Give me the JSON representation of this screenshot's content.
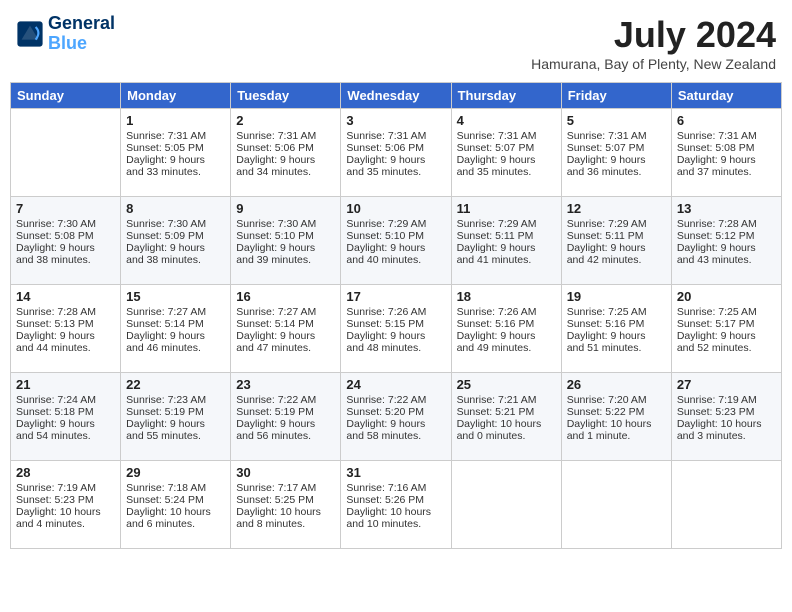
{
  "header": {
    "logo_line1": "General",
    "logo_line2": "Blue",
    "month_year": "July 2024",
    "location": "Hamurana, Bay of Plenty, New Zealand"
  },
  "days_of_week": [
    "Sunday",
    "Monday",
    "Tuesday",
    "Wednesday",
    "Thursday",
    "Friday",
    "Saturday"
  ],
  "weeks": [
    [
      {
        "day": "",
        "sunrise": "",
        "sunset": "",
        "daylight": ""
      },
      {
        "day": "1",
        "sunrise": "Sunrise: 7:31 AM",
        "sunset": "Sunset: 5:05 PM",
        "daylight": "Daylight: 9 hours and 33 minutes."
      },
      {
        "day": "2",
        "sunrise": "Sunrise: 7:31 AM",
        "sunset": "Sunset: 5:06 PM",
        "daylight": "Daylight: 9 hours and 34 minutes."
      },
      {
        "day": "3",
        "sunrise": "Sunrise: 7:31 AM",
        "sunset": "Sunset: 5:06 PM",
        "daylight": "Daylight: 9 hours and 35 minutes."
      },
      {
        "day": "4",
        "sunrise": "Sunrise: 7:31 AM",
        "sunset": "Sunset: 5:07 PM",
        "daylight": "Daylight: 9 hours and 35 minutes."
      },
      {
        "day": "5",
        "sunrise": "Sunrise: 7:31 AM",
        "sunset": "Sunset: 5:07 PM",
        "daylight": "Daylight: 9 hours and 36 minutes."
      },
      {
        "day": "6",
        "sunrise": "Sunrise: 7:31 AM",
        "sunset": "Sunset: 5:08 PM",
        "daylight": "Daylight: 9 hours and 37 minutes."
      }
    ],
    [
      {
        "day": "7",
        "sunrise": "Sunrise: 7:30 AM",
        "sunset": "Sunset: 5:08 PM",
        "daylight": "Daylight: 9 hours and 38 minutes."
      },
      {
        "day": "8",
        "sunrise": "Sunrise: 7:30 AM",
        "sunset": "Sunset: 5:09 PM",
        "daylight": "Daylight: 9 hours and 38 minutes."
      },
      {
        "day": "9",
        "sunrise": "Sunrise: 7:30 AM",
        "sunset": "Sunset: 5:10 PM",
        "daylight": "Daylight: 9 hours and 39 minutes."
      },
      {
        "day": "10",
        "sunrise": "Sunrise: 7:29 AM",
        "sunset": "Sunset: 5:10 PM",
        "daylight": "Daylight: 9 hours and 40 minutes."
      },
      {
        "day": "11",
        "sunrise": "Sunrise: 7:29 AM",
        "sunset": "Sunset: 5:11 PM",
        "daylight": "Daylight: 9 hours and 41 minutes."
      },
      {
        "day": "12",
        "sunrise": "Sunrise: 7:29 AM",
        "sunset": "Sunset: 5:11 PM",
        "daylight": "Daylight: 9 hours and 42 minutes."
      },
      {
        "day": "13",
        "sunrise": "Sunrise: 7:28 AM",
        "sunset": "Sunset: 5:12 PM",
        "daylight": "Daylight: 9 hours and 43 minutes."
      }
    ],
    [
      {
        "day": "14",
        "sunrise": "Sunrise: 7:28 AM",
        "sunset": "Sunset: 5:13 PM",
        "daylight": "Daylight: 9 hours and 44 minutes."
      },
      {
        "day": "15",
        "sunrise": "Sunrise: 7:27 AM",
        "sunset": "Sunset: 5:14 PM",
        "daylight": "Daylight: 9 hours and 46 minutes."
      },
      {
        "day": "16",
        "sunrise": "Sunrise: 7:27 AM",
        "sunset": "Sunset: 5:14 PM",
        "daylight": "Daylight: 9 hours and 47 minutes."
      },
      {
        "day": "17",
        "sunrise": "Sunrise: 7:26 AM",
        "sunset": "Sunset: 5:15 PM",
        "daylight": "Daylight: 9 hours and 48 minutes."
      },
      {
        "day": "18",
        "sunrise": "Sunrise: 7:26 AM",
        "sunset": "Sunset: 5:16 PM",
        "daylight": "Daylight: 9 hours and 49 minutes."
      },
      {
        "day": "19",
        "sunrise": "Sunrise: 7:25 AM",
        "sunset": "Sunset: 5:16 PM",
        "daylight": "Daylight: 9 hours and 51 minutes."
      },
      {
        "day": "20",
        "sunrise": "Sunrise: 7:25 AM",
        "sunset": "Sunset: 5:17 PM",
        "daylight": "Daylight: 9 hours and 52 minutes."
      }
    ],
    [
      {
        "day": "21",
        "sunrise": "Sunrise: 7:24 AM",
        "sunset": "Sunset: 5:18 PM",
        "daylight": "Daylight: 9 hours and 54 minutes."
      },
      {
        "day": "22",
        "sunrise": "Sunrise: 7:23 AM",
        "sunset": "Sunset: 5:19 PM",
        "daylight": "Daylight: 9 hours and 55 minutes."
      },
      {
        "day": "23",
        "sunrise": "Sunrise: 7:22 AM",
        "sunset": "Sunset: 5:19 PM",
        "daylight": "Daylight: 9 hours and 56 minutes."
      },
      {
        "day": "24",
        "sunrise": "Sunrise: 7:22 AM",
        "sunset": "Sunset: 5:20 PM",
        "daylight": "Daylight: 9 hours and 58 minutes."
      },
      {
        "day": "25",
        "sunrise": "Sunrise: 7:21 AM",
        "sunset": "Sunset: 5:21 PM",
        "daylight": "Daylight: 10 hours and 0 minutes."
      },
      {
        "day": "26",
        "sunrise": "Sunrise: 7:20 AM",
        "sunset": "Sunset: 5:22 PM",
        "daylight": "Daylight: 10 hours and 1 minute."
      },
      {
        "day": "27",
        "sunrise": "Sunrise: 7:19 AM",
        "sunset": "Sunset: 5:23 PM",
        "daylight": "Daylight: 10 hours and 3 minutes."
      }
    ],
    [
      {
        "day": "28",
        "sunrise": "Sunrise: 7:19 AM",
        "sunset": "Sunset: 5:23 PM",
        "daylight": "Daylight: 10 hours and 4 minutes."
      },
      {
        "day": "29",
        "sunrise": "Sunrise: 7:18 AM",
        "sunset": "Sunset: 5:24 PM",
        "daylight": "Daylight: 10 hours and 6 minutes."
      },
      {
        "day": "30",
        "sunrise": "Sunrise: 7:17 AM",
        "sunset": "Sunset: 5:25 PM",
        "daylight": "Daylight: 10 hours and 8 minutes."
      },
      {
        "day": "31",
        "sunrise": "Sunrise: 7:16 AM",
        "sunset": "Sunset: 5:26 PM",
        "daylight": "Daylight: 10 hours and 10 minutes."
      },
      {
        "day": "",
        "sunrise": "",
        "sunset": "",
        "daylight": ""
      },
      {
        "day": "",
        "sunrise": "",
        "sunset": "",
        "daylight": ""
      },
      {
        "day": "",
        "sunrise": "",
        "sunset": "",
        "daylight": ""
      }
    ]
  ]
}
